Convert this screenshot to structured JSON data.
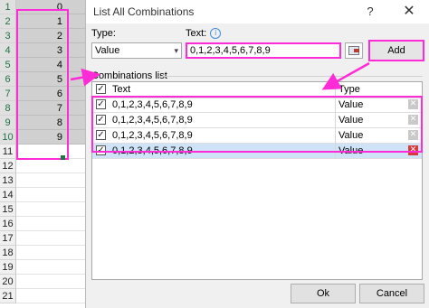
{
  "sheet": {
    "rows": [
      {
        "n": "1",
        "v": "0",
        "sel": true
      },
      {
        "n": "2",
        "v": "1",
        "sel": true
      },
      {
        "n": "3",
        "v": "2",
        "sel": true
      },
      {
        "n": "4",
        "v": "3",
        "sel": true
      },
      {
        "n": "5",
        "v": "4",
        "sel": true
      },
      {
        "n": "6",
        "v": "5",
        "sel": true
      },
      {
        "n": "7",
        "v": "6",
        "sel": true
      },
      {
        "n": "8",
        "v": "7",
        "sel": true
      },
      {
        "n": "9",
        "v": "8",
        "sel": true
      },
      {
        "n": "10",
        "v": "9",
        "sel": true
      },
      {
        "n": "11",
        "v": "",
        "sel": false
      },
      {
        "n": "12",
        "v": "",
        "sel": false
      },
      {
        "n": "13",
        "v": "",
        "sel": false
      },
      {
        "n": "14",
        "v": "",
        "sel": false
      },
      {
        "n": "15",
        "v": "",
        "sel": false
      },
      {
        "n": "16",
        "v": "",
        "sel": false
      },
      {
        "n": "17",
        "v": "",
        "sel": false
      },
      {
        "n": "18",
        "v": "",
        "sel": false
      },
      {
        "n": "19",
        "v": "",
        "sel": false
      },
      {
        "n": "20",
        "v": "",
        "sel": false
      },
      {
        "n": "21",
        "v": "",
        "sel": false
      }
    ]
  },
  "dialog": {
    "title": "List All Combinations",
    "help": "?",
    "close": "✕",
    "type_label": "Type:",
    "type_value": "Value",
    "text_label": "Text:",
    "text_value": "0,1,2,3,4,5,6,7,8,9",
    "add_label": "Add",
    "combos_label": "Combinations list",
    "col_text": "Text",
    "col_type": "Type",
    "items": [
      {
        "text": "0,1,2,3,4,5,6,7,8,9",
        "type": "Value",
        "checked": true,
        "selected": false
      },
      {
        "text": "0,1,2,3,4,5,6,7,8,9",
        "type": "Value",
        "checked": true,
        "selected": false
      },
      {
        "text": "0,1,2,3,4,5,6,7,8,9",
        "type": "Value",
        "checked": true,
        "selected": false
      },
      {
        "text": "0,1,2,3,4,5,6,7,8,9",
        "type": "Value",
        "checked": true,
        "selected": true
      }
    ],
    "ok_label": "Ok",
    "cancel_label": "Cancel"
  },
  "colors": {
    "highlight": "#ff2bd6",
    "selection": "#cfe3f8",
    "delete_active": "#d9393a"
  }
}
